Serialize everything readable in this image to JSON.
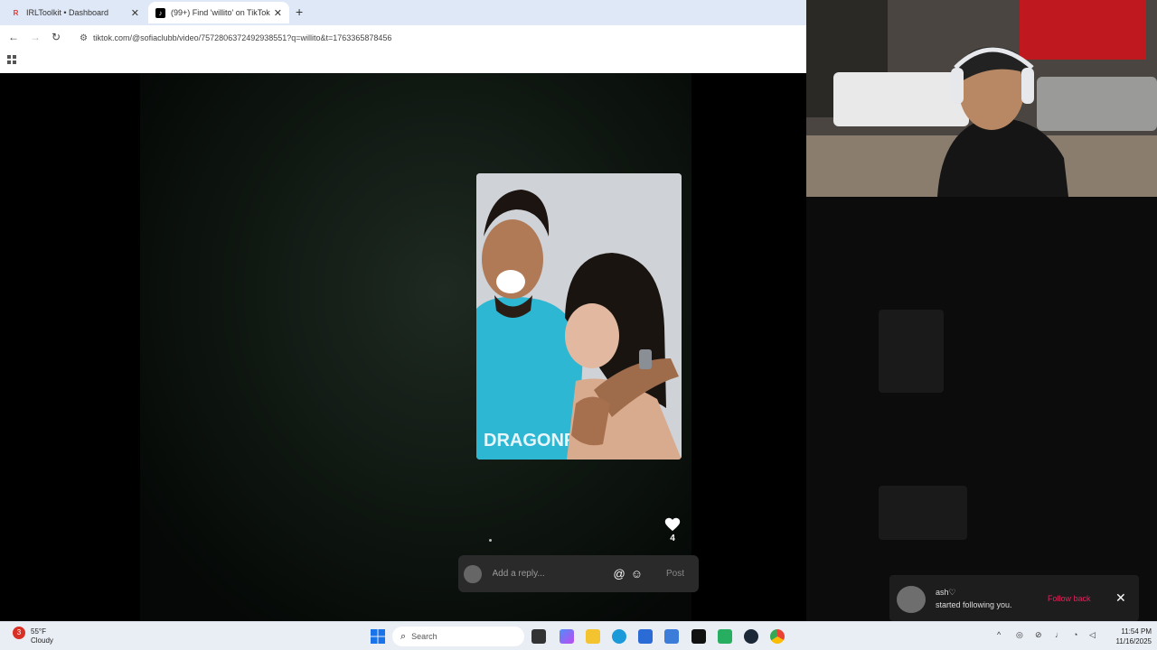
{
  "browser": {
    "tabs": [
      {
        "title": "IRLToolkit • Dashboard",
        "favicon": "irltoolkit-icon",
        "active": false
      },
      {
        "title": "(99+) Find 'willito' on TikTok | Ti",
        "favicon": "tiktok-icon",
        "active": true
      }
    ],
    "new_tab_label": "+",
    "close_label": "✕",
    "url": "tiktok.com/@sofiaclubb/video/7572806372492938551?q=willito&t=1763365878456"
  },
  "post": {
    "likes": "4",
    "reply_placeholder": "Add a reply...",
    "mention_symbol": "@",
    "emoji_symbol": "☺",
    "post_label": "Post"
  },
  "notification": {
    "username": "ash♡",
    "message": "started following you.",
    "action_label": "Follow back",
    "close_label": "✕"
  },
  "taskbar": {
    "weather_badge": "3",
    "temperature": "55°F",
    "condition": "Cloudy",
    "search_label": "Search",
    "time": "11:54 PM",
    "date": "11/16/2025"
  },
  "colors": {
    "accent_pink": "#e0245e",
    "tab_strip": "#dfe8f6",
    "taskbar": "#e9eef5"
  }
}
